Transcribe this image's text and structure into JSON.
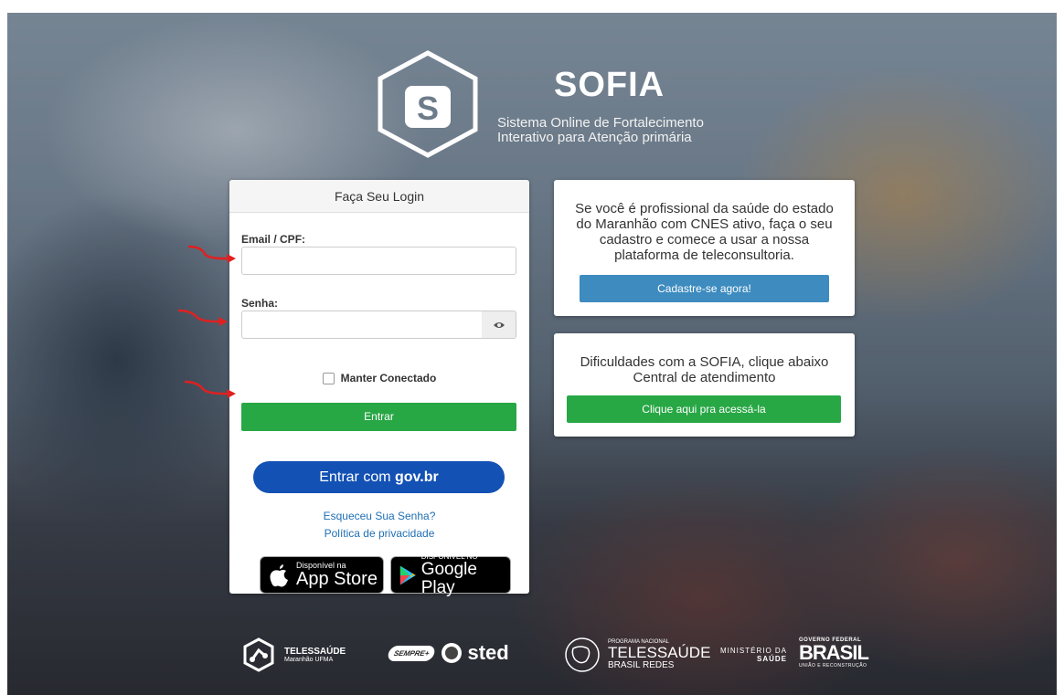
{
  "app": {
    "logo_letter": "S",
    "title": "SOFIA",
    "subtitle_line1": "Sistema Online de Fortalecimento",
    "subtitle_line2": "Interativo para Atenção primária"
  },
  "login": {
    "header": "Faça Seu Login",
    "email_label": "Email / CPF:",
    "email_value": "",
    "password_label": "Senha:",
    "password_value": "",
    "remember_label": "Manter Conectado",
    "submit_label": "Entrar",
    "gov_label_prefix": "Entrar com ",
    "gov_label_brand": "gov.br",
    "forgot_link": "Esqueceu Sua Senha?",
    "privacy_link": "Política de privacidade",
    "appstore_small": "Disponível na",
    "appstore_big": "App Store",
    "googleplay_small": "DISPONÍVEL NO",
    "googleplay_big": "Google Play"
  },
  "signup_card": {
    "text_line1": "Se você é profissional da saúde do estado",
    "text_line2": "do Maranhão com CNES ativo, faça o seu",
    "text_line3": "cadastro e comece a usar a nossa",
    "text_line4": "plataforma de teleconsultoria.",
    "button": "Cadastre-se agora!"
  },
  "support_card": {
    "text_line1": "Dificuldades com a SOFIA, clique abaixo",
    "text_line2": "Central de atendimento",
    "button": "Clique aqui pra acessá-la"
  },
  "footer": {
    "telessaude_title": "TELESSAÚDE",
    "telessaude_sub": "Maranhão UFMA",
    "semprec": "SEMPRE+",
    "sted": "sted",
    "programa_small": "PROGRAMA NACIONAL",
    "programa_title": "TELESSAÚDE",
    "programa_sub": "BRASIL REDES",
    "ministerio_line1": "MINISTÉRIO DA",
    "ministerio_line2": "SAÚDE",
    "governo": "GOVERNO FEDERAL",
    "brasil": "BRASIL",
    "brasil_sub": "UNIÃO E RECONSTRUÇÃO"
  },
  "colors": {
    "green": "#28a745",
    "gov_blue": "#1351b4",
    "blue": "#3d8bbf",
    "arrow_red": "#e02020"
  },
  "icons": [
    "eye-icon",
    "apple-icon",
    "google-play-icon",
    "arrow-icon"
  ]
}
